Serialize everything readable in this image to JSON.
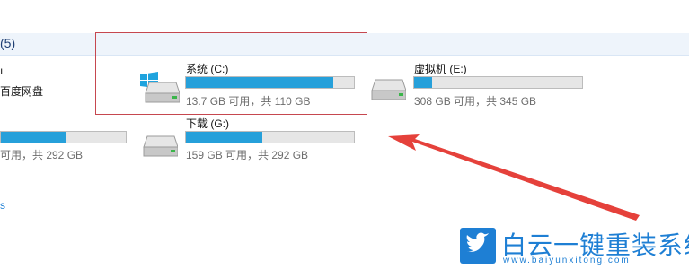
{
  "group": {
    "count_label": "(5)"
  },
  "partial_left": {
    "item1_label": "百度网盘",
    "item2_free": "可用，共 292 GB",
    "item2_used_fraction": 0.52,
    "item3_label": "s"
  },
  "drives": [
    {
      "name": "系统 (C:)",
      "free_text": "13.7 GB 可用，共 110 GB",
      "used_fraction": 0.876,
      "icon": "windows-drive-icon"
    },
    {
      "name": "虚拟机 (E:)",
      "free_text": "308 GB 可用，共 345 GB",
      "used_fraction": 0.107,
      "icon": "hard-drive-icon"
    },
    {
      "name": "下载 (G:)",
      "free_text": "159 GB 可用，共 292 GB",
      "used_fraction": 0.455,
      "icon": "hard-drive-icon"
    }
  ],
  "watermark": {
    "title": "白云一键重装系统",
    "url": "www.baiyunxitong.com",
    "icon": "twitter-bird-icon"
  },
  "colors": {
    "bar_fill": "#26a0da",
    "highlight": "#c6474f",
    "arrow": "#e5413b",
    "watermark": "#1e7fd4"
  }
}
